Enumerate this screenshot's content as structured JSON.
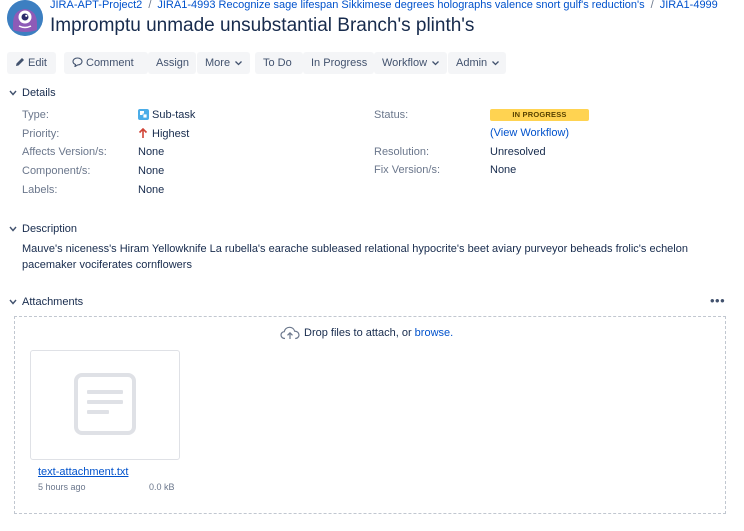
{
  "breadcrumb": {
    "project": "JIRA-APT-Project2",
    "parent": "JIRA1-4993 Recognize sage lifespan Sikkimese degrees holographs valence snort gulf's reduction's",
    "issue": "JIRA1-4999",
    "separator": "/"
  },
  "issue": {
    "title": "Impromptu unmade unsubstantial Branch's plinth's"
  },
  "toolbar": {
    "edit": "Edit",
    "comment": "Comment",
    "assign": "Assign",
    "more": "More",
    "todo": "To Do",
    "in_progress": "In Progress",
    "workflow": "Workflow",
    "admin": "Admin"
  },
  "details": {
    "heading": "Details",
    "type_label": "Type:",
    "type_value": "Sub-task",
    "priority_label": "Priority:",
    "priority_value": "Highest",
    "affects_label": "Affects Version/s:",
    "affects_value": "None",
    "component_label": "Component/s:",
    "component_value": "None",
    "labels_label": "Labels:",
    "labels_value": "None",
    "status_label": "Status:",
    "status_value": "IN PROGRESS",
    "view_workflow": "(View Workflow)",
    "resolution_label": "Resolution:",
    "resolution_value": "Unresolved",
    "fix_label": "Fix Version/s:",
    "fix_value": "None"
  },
  "description": {
    "heading": "Description",
    "text": "Mauve's niceness's Hiram Yellowknife La rubella's earache subleased relational hypocrite's beet aviary purveyor beheads frolic's echelon pacemaker vociferates cornflowers"
  },
  "attachments": {
    "heading": "Attachments",
    "more": "•••",
    "drop_text": "Drop files to attach, or ",
    "browse": "browse.",
    "file_name": "text-attachment.txt",
    "file_age": "5 hours ago",
    "file_size": "0.0 kB"
  },
  "colors": {
    "link": "#0052cc",
    "status_bg": "#ffd351",
    "button_bg": "#f4f5f7",
    "priority_highest": "#d04437"
  },
  "icons": {
    "avatar": "monster-avatar-icon",
    "edit": "pencil-icon",
    "comment": "speech-bubble-icon",
    "subtask": "subtask-icon",
    "priority": "arrow-up-icon",
    "upload": "cloud-upload-icon",
    "file": "document-icon"
  }
}
